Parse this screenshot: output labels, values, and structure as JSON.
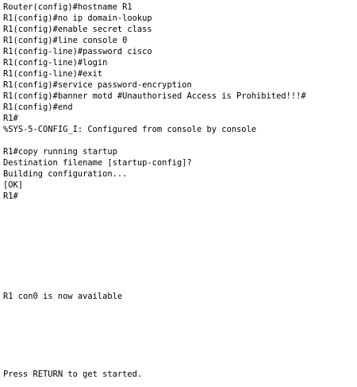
{
  "terminal": {
    "lines": [
      "Router(config)#hostname R1",
      "R1(config)#no ip domain-lookup",
      "R1(config)#enable secret class",
      "R1(config)#line console 0",
      "R1(config-line)#password cisco",
      "R1(config-line)#login",
      "R1(config-line)#exit",
      "R1(config)#service password-encryption",
      "R1(config)#banner motd #Unauthorised Access is Prohibited!!!#",
      "R1(config)#end",
      "R1#",
      "%SYS-5-CONFIG_I: Configured from console by console",
      "",
      "R1#copy running startup",
      "Destination filename [startup-config]?",
      "Building configuration...",
      "[OK]",
      "R1#",
      "",
      "",
      "",
      "",
      "",
      "",
      "",
      "",
      "R1 con0 is now available",
      "",
      "",
      "",
      "",
      "",
      "",
      "Press RETURN to get started."
    ]
  }
}
